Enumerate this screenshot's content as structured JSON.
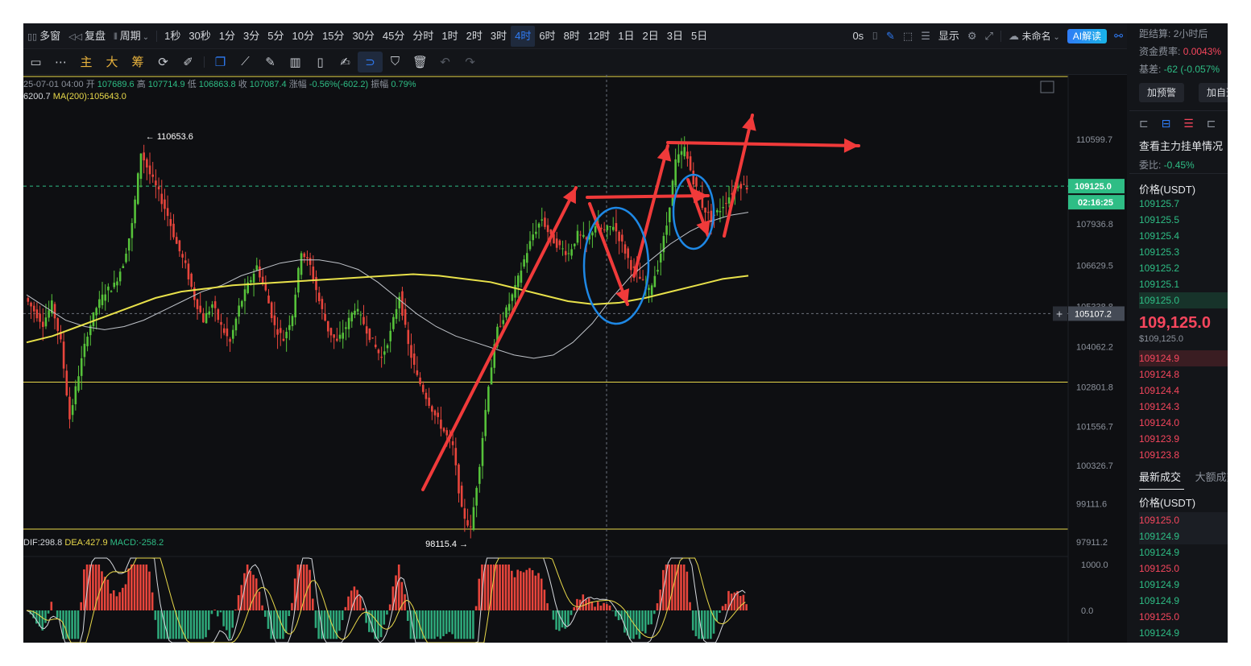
{
  "topbar": {
    "items": [
      "多窗",
      "复盘",
      "周期",
      "1秒",
      "30秒",
      "1分",
      "3分",
      "5分",
      "10分",
      "15分",
      "30分",
      "45分",
      "分时",
      "1时",
      "2时",
      "3时",
      "4时",
      "6时",
      "8时",
      "12时",
      "1日",
      "2日",
      "3日",
      "5日"
    ],
    "active": "4时",
    "timer": "0s",
    "display": "显示",
    "unnamed": "未命名",
    "ai": "AI解读"
  },
  "toolbar2": {
    "labels": [
      "主",
      "大",
      "筹"
    ]
  },
  "ohlc": {
    "date": "25-07-01 04:00",
    "open_label": "开",
    "open": "107689.6",
    "high_label": "高",
    "high": "107714.9",
    "low_label": "低",
    "low": "106863.8",
    "close_label": "收",
    "close": "107087.4",
    "change_label": "涨幅",
    "change": "-0.56%(-602.2)",
    "amp_label": "振幅",
    "amp": "0.79%"
  },
  "ma": {
    "prefix": "6200.7",
    "label": "MA(200):105643.0"
  },
  "macd": {
    "dif": "DIF:298.8",
    "dea": "DEA:427.9",
    "macd": "MACD:-258.2"
  },
  "side": {
    "settle_label": "距结算:",
    "settle_value": "2小时后",
    "funding_label": "资金费率:",
    "funding_value": "0.0043%",
    "basis_label": "基差:",
    "basis_value": "-62 (-0.057%",
    "alert_btn": "加预警",
    "add_btn": "加自选",
    "orderbook_title": "查看主力挂单情况",
    "ratio_label": "委比:",
    "ratio_value": "-0.45%",
    "price_header": "价格(USDT)",
    "asks": [
      "109125.7",
      "109125.5",
      "109125.4",
      "109125.3",
      "109125.2",
      "109125.1",
      "109125.0"
    ],
    "last_price": "109,125.0",
    "last_price_usd": "$109,125.0",
    "bids": [
      "109124.9",
      "109124.8",
      "109124.4",
      "109124.3",
      "109124.0",
      "109123.9",
      "109123.8"
    ],
    "trades_title": "最新成交",
    "trades_tab2": "大额成交",
    "trades_header": "价格(USDT)",
    "trades": [
      {
        "p": "109125.0",
        "c": "red"
      },
      {
        "p": "109124.9",
        "c": "green"
      },
      {
        "p": "109124.9",
        "c": "green"
      },
      {
        "p": "109125.0",
        "c": "red"
      },
      {
        "p": "109124.9",
        "c": "green"
      },
      {
        "p": "109124.9",
        "c": "green"
      },
      {
        "p": "109125.0",
        "c": "red"
      },
      {
        "p": "109124.9",
        "c": "green"
      }
    ]
  },
  "chart_data": {
    "type": "candlestick",
    "interval": "4时",
    "ylim": [
      97911.2,
      110599.7
    ],
    "y_ticks": [
      110599.7,
      107936.8,
      106629.5,
      105338.8,
      104062.2,
      102801.8,
      101556.7,
      100326.7,
      99111.6,
      97911.2
    ],
    "y_tick_labels": [
      "110599.7",
      "107936.8",
      "106629.5",
      "105338.8",
      "104062.2",
      "102801.8",
      "101556.7",
      "100326.7",
      "99111.6",
      "97911.2"
    ],
    "current_price": 109125.0,
    "current_price_label": "109125.0",
    "countdown": "02:16:25",
    "crosshair_price": 105107.2,
    "crosshair_label": "105107.2",
    "annotations": {
      "high": {
        "value": 110653.6,
        "label": "← 110653.6"
      },
      "low": {
        "value": 98115.4,
        "label": "98115.4 →"
      }
    },
    "horizontal_lines": [
      102950.0
    ],
    "close_path": [
      105600,
      105200,
      104800,
      105400,
      104200,
      101800,
      103200,
      104500,
      105300,
      105800,
      106000,
      106700,
      107900,
      110200,
      109500,
      108900,
      108200,
      107300,
      106600,
      105600,
      104900,
      105400,
      104700,
      104200,
      105300,
      106000,
      106600,
      105800,
      104700,
      104300,
      105100,
      107100,
      106600,
      105500,
      104600,
      104200,
      104700,
      105300,
      104800,
      104200,
      103700,
      104500,
      105700,
      104100,
      103100,
      102500,
      101900,
      101400,
      100900,
      98900,
      98300,
      100400,
      102900,
      104600,
      105200,
      105900,
      106800,
      107600,
      108100,
      107500,
      107200,
      107000,
      107600,
      107400,
      107900,
      107700,
      107900,
      107300,
      106600,
      106200,
      105800,
      106600,
      107900,
      109900,
      110300,
      109300,
      108500,
      108100,
      108400,
      108800,
      109200,
      109100
    ],
    "ma_white": [
      105700,
      105300,
      104900,
      104700,
      104600,
      104700,
      104900,
      105200,
      105500,
      105800,
      106000,
      106300,
      106500,
      106700,
      106800,
      106800,
      106700,
      106500,
      106100,
      105600,
      105100,
      104700,
      104400,
      104200,
      104000,
      103800,
      103700,
      103800,
      104200,
      104800,
      105600,
      106300,
      106800,
      107300,
      107700,
      108000,
      108200,
      108300
    ],
    "ma_yellow": [
      104200,
      104400,
      104700,
      105000,
      105300,
      105600,
      105800,
      105900,
      106000,
      106050,
      106100,
      106150,
      106200,
      106250,
      106300,
      106350,
      106300,
      106200,
      106100,
      105900,
      105700,
      105500,
      105400,
      105450,
      105600,
      105800,
      106000,
      106200,
      106300
    ],
    "macd": {
      "ylim": [
        -700,
        1300
      ],
      "y_tick_labels": [
        "1000.0",
        "0.0"
      ],
      "y_ticks": [
        1000,
        0
      ]
    }
  }
}
